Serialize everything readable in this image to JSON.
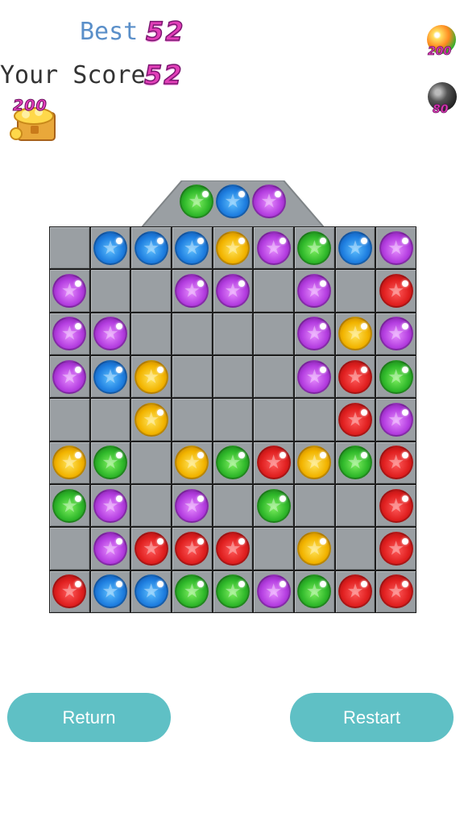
{
  "header": {
    "best_label": "Best",
    "best_value": "52",
    "score_label": "Your Score",
    "score_value": "52",
    "treasure_count": "200"
  },
  "powerups": [
    {
      "icon": "rainbow-ball-icon",
      "count": "200"
    },
    {
      "icon": "bomb-icon",
      "count": "80"
    }
  ],
  "next_balls": [
    "green",
    "blue",
    "purple"
  ],
  "board": {
    "rows": 9,
    "cols": 9,
    "cells": [
      [
        "",
        "blue",
        "blue",
        "blue",
        "yellow",
        "purple",
        "green",
        "blue",
        "purple"
      ],
      [
        "purple",
        "",
        "",
        "purple",
        "purple",
        "",
        "purple",
        "",
        "red"
      ],
      [
        "purple",
        "purple",
        "",
        "",
        "",
        "",
        "purple",
        "yellow",
        "purple"
      ],
      [
        "purple",
        "blue",
        "yellow",
        "",
        "",
        "",
        "purple",
        "red",
        "green"
      ],
      [
        "",
        "",
        "yellow",
        "",
        "",
        "",
        "",
        "red",
        "purple"
      ],
      [
        "yellow",
        "green",
        "",
        "yellow",
        "green",
        "red",
        "yellow",
        "green",
        "red"
      ],
      [
        "green",
        "purple",
        "",
        "purple",
        "",
        "green",
        "",
        "",
        "red"
      ],
      [
        "",
        "purple",
        "red",
        "red",
        "red",
        "",
        "yellow",
        "",
        "red"
      ],
      [
        "red",
        "blue",
        "blue",
        "green",
        "green",
        "purple",
        "green",
        "red",
        "red"
      ]
    ]
  },
  "buttons": {
    "return_label": "Return",
    "restart_label": "Restart"
  },
  "colors": {
    "button": "#5fc0c5",
    "score_digits": "#e23fb8",
    "best_label": "#5a8fc9",
    "cell": "#9a9fa3",
    "grid_line": "#1e1e1e"
  }
}
